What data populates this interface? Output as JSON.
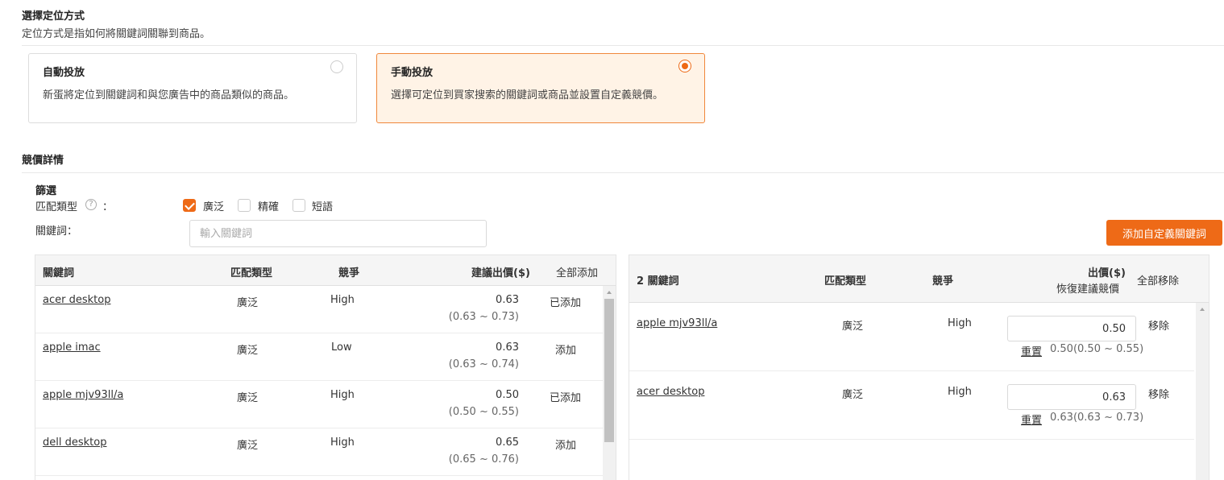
{
  "targeting": {
    "title": "選擇定位方式",
    "description": "定位方式是指如何將關鍵詞關聯到商品。",
    "options": [
      {
        "title": "自動投放",
        "description": "新蛋將定位到關鍵詞和與您廣告中的商品類似的商品。",
        "selected": false
      },
      {
        "title": "手動投放",
        "description": "選擇可定位到買家搜索的關鍵詞或商品並設置自定義競價。",
        "selected": true
      }
    ]
  },
  "bid_details": {
    "title": "競價詳情",
    "filter": {
      "title": "篩選",
      "match_type_label": "匹配類型",
      "colon": "：",
      "help_icon": "question-circle-icon",
      "checkboxes": [
        {
          "label": "廣泛",
          "checked": true
        },
        {
          "label": "精確",
          "checked": false
        },
        {
          "label": "短語",
          "checked": false
        }
      ],
      "keyword_label": "關鍵詞：",
      "keyword_placeholder": "輸入關鍵詞"
    },
    "add_custom_button": "添加自定義關鍵詞"
  },
  "suggested_table": {
    "headers": {
      "keyword": "關鍵詞",
      "match_type": "匹配類型",
      "competition": "競爭",
      "suggested_bid": "建議出價($)",
      "add_all": "全部添加"
    },
    "rows": [
      {
        "keyword": "acer desktop",
        "match_type": "廣泛",
        "competition": "High",
        "bid": "0.63",
        "range": "(0.63 ~ 0.73)",
        "action": "已添加",
        "added": true
      },
      {
        "keyword": "apple imac",
        "match_type": "廣泛",
        "competition": "Low",
        "bid": "0.63",
        "range": "(0.63 ~ 0.74)",
        "action": "添加",
        "added": false
      },
      {
        "keyword": "apple mjv93ll/a",
        "match_type": "廣泛",
        "competition": "High",
        "bid": "0.50",
        "range": "(0.50 ~ 0.55)",
        "action": "已添加",
        "added": true
      },
      {
        "keyword": "dell desktop",
        "match_type": "廣泛",
        "competition": "High",
        "bid": "0.65",
        "range": "(0.65 ~ 0.76)",
        "action": "添加",
        "added": false
      }
    ]
  },
  "selected_table": {
    "headers": {
      "count_keyword": "2 關鍵詞",
      "match_type": "匹配類型",
      "competition": "競爭",
      "bid": "出價($)",
      "restore": "恢復建議競價",
      "remove_all": "全部移除"
    },
    "rows": [
      {
        "keyword": "apple mjv93ll/a",
        "match_type": "廣泛",
        "competition": "High",
        "bid_value": "0.50",
        "reset": "重置",
        "suggest": "0.50(0.50 ~ 0.55)",
        "remove": "移除"
      },
      {
        "keyword": "acer desktop",
        "match_type": "廣泛",
        "competition": "High",
        "bid_value": "0.63",
        "reset": "重置",
        "suggest": "0.63(0.63 ~ 0.73)",
        "remove": "移除"
      }
    ]
  },
  "colors": {
    "accent": "#ee6a17",
    "selected_bg": "#fff3e6"
  }
}
